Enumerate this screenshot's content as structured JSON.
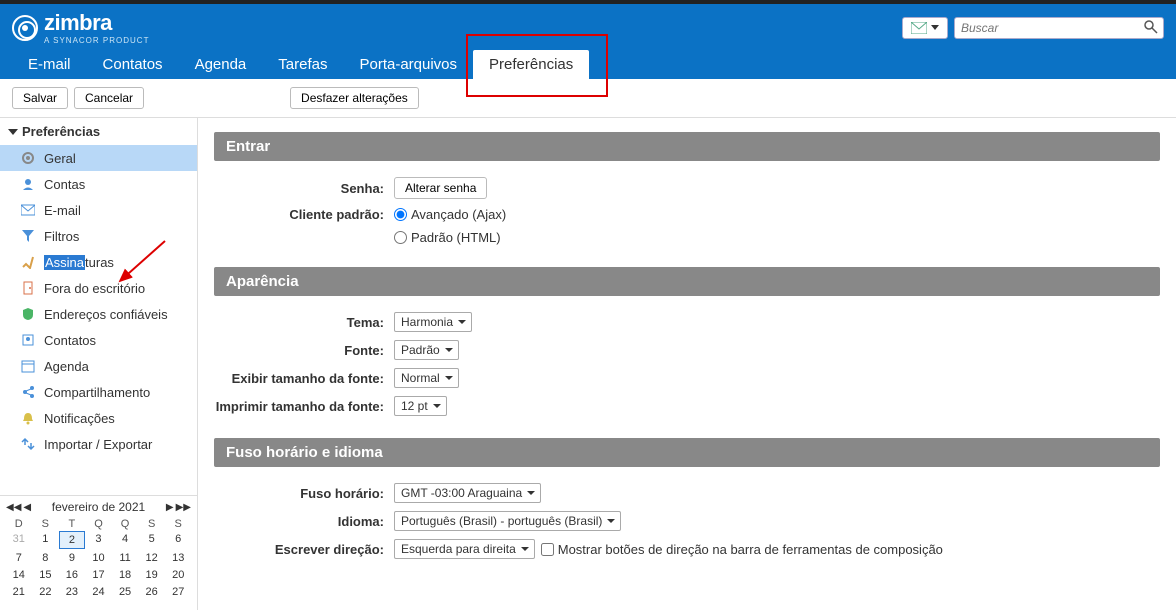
{
  "brand": {
    "name": "zimbra",
    "sub": "A SYNACOR PRODUCT"
  },
  "search": {
    "placeholder": "Buscar"
  },
  "nav": {
    "tabs": [
      "E-mail",
      "Contatos",
      "Agenda",
      "Tarefas",
      "Porta-arquivos",
      "Preferências"
    ]
  },
  "toolbar": {
    "save": "Salvar",
    "cancel": "Cancelar",
    "undo": "Desfazer alterações"
  },
  "sidebar": {
    "header": "Preferências",
    "items": [
      "Geral",
      "Contas",
      "E-mail",
      "Filtros",
      "Assinaturas",
      "Fora do escritório",
      "Endereços confiáveis",
      "Contatos",
      "Agenda",
      "Compartilhamento",
      "Notificações",
      "Importar / Exportar"
    ],
    "highlighted_item_prefix": "Assina",
    "highlighted_item_suffix": "turas"
  },
  "calendar": {
    "month": "fevereiro de 2021",
    "dow": [
      "D",
      "S",
      "T",
      "Q",
      "Q",
      "S",
      "S"
    ],
    "weeks": [
      [
        "31",
        "1",
        "2",
        "3",
        "4",
        "5",
        "6"
      ],
      [
        "7",
        "8",
        "9",
        "10",
        "11",
        "12",
        "13"
      ],
      [
        "14",
        "15",
        "16",
        "17",
        "18",
        "19",
        "20"
      ],
      [
        "21",
        "22",
        "23",
        "24",
        "25",
        "26",
        "27"
      ]
    ],
    "today": "2"
  },
  "sections": {
    "login": {
      "title": "Entrar",
      "password_label": "Senha:",
      "change_pw": "Alterar senha",
      "client_label": "Cliente padrão:",
      "client_adv": "Avançado (Ajax)",
      "client_std": "Padrão (HTML)"
    },
    "appearance": {
      "title": "Aparência",
      "theme_label": "Tema:",
      "theme_value": "Harmonia",
      "font_label": "Fonte:",
      "font_value": "Padrão",
      "fontsize_label": "Exibir tamanho da fonte:",
      "fontsize_value": "Normal",
      "printsize_label": "Imprimir tamanho da fonte:",
      "printsize_value": "12 pt"
    },
    "tz": {
      "title": "Fuso horário e idioma",
      "tz_label": "Fuso horário:",
      "tz_value": "GMT -03:00 Araguaina",
      "lang_label": "Idioma:",
      "lang_value": "Português (Brasil) - português (Brasil)",
      "dir_label": "Escrever direção:",
      "dir_value": "Esquerda para direita",
      "dir_check": "Mostrar botões de direção na barra de ferramentas de composição"
    }
  }
}
